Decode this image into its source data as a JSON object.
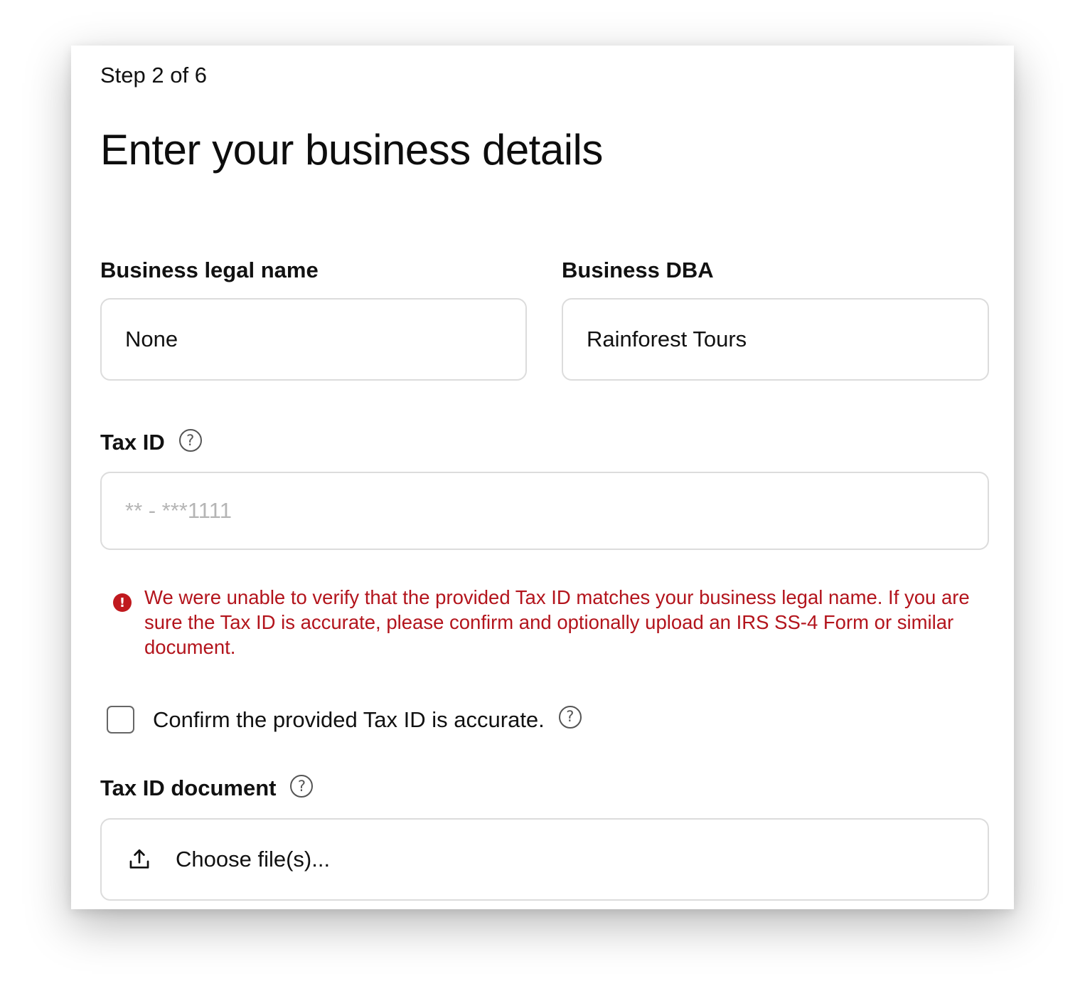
{
  "header": {
    "step": "Step 2 of 6",
    "title": "Enter your business details"
  },
  "form": {
    "legal_name": {
      "label": "Business legal name",
      "value": "None"
    },
    "dba": {
      "label": "Business DBA",
      "value": "Rainforest Tours"
    },
    "tax_id": {
      "label": "Tax ID",
      "help_icon": "question-circle-icon",
      "placeholder": "** - ***1111",
      "value": ""
    },
    "error": {
      "icon": "alert-circle-icon",
      "color": "#b3141c",
      "message": "We were unable to verify that the provided Tax ID matches your business legal name. If you are sure the Tax ID is accurate, please confirm and optionally upload an IRS SS-4 Form or similar document."
    },
    "confirm": {
      "label": "Confirm the provided Tax ID is accurate.",
      "checked": false,
      "help_icon": "question-circle-icon"
    },
    "tax_doc": {
      "label": "Tax ID document",
      "help_icon": "question-circle-icon",
      "upload_icon": "upload-icon",
      "button_label": "Choose file(s)..."
    }
  }
}
